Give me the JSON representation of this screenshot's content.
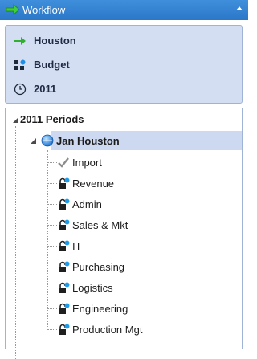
{
  "header": {
    "title": "Workflow",
    "arrow_icon": "green-arrow-icon",
    "collapse_icon": "chevron-up-icon"
  },
  "pov": {
    "items": [
      {
        "label": "Houston",
        "icon": "green-arrow-icon"
      },
      {
        "label": "Budget",
        "icon": "scenario-blocks-icon"
      },
      {
        "label": "2011",
        "icon": "clock-icon"
      }
    ]
  },
  "tree": {
    "root_label": "2011 Periods",
    "selected_node": {
      "label": "Jan Houston",
      "icon": "blue-globe-icon"
    },
    "children": [
      {
        "label": "Import",
        "icon": "checkmark-icon"
      },
      {
        "label": "Revenue",
        "icon": "lock-icon"
      },
      {
        "label": "Admin",
        "icon": "lock-icon"
      },
      {
        "label": "Sales & Mkt",
        "icon": "lock-icon"
      },
      {
        "label": "IT",
        "icon": "lock-icon"
      },
      {
        "label": "Purchasing",
        "icon": "lock-icon"
      },
      {
        "label": "Logistics",
        "icon": "lock-icon"
      },
      {
        "label": "Engineering",
        "icon": "lock-icon"
      },
      {
        "label": "Production Mgt",
        "icon": "lock-icon"
      }
    ]
  },
  "colors": {
    "header": "#2f80d2",
    "pov_bg": "#d4def3",
    "selection": "#cdd9f1",
    "accent_green": "#22a322"
  }
}
